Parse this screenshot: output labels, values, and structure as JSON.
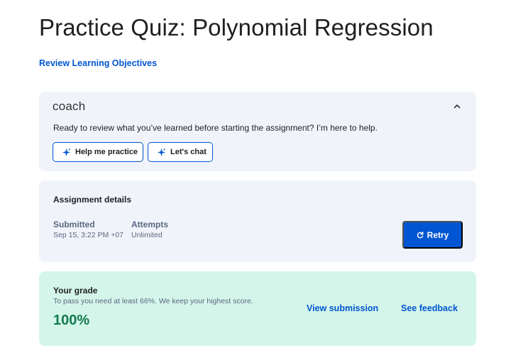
{
  "page": {
    "title": "Practice Quiz: Polynomial Regression",
    "objectives_link": "Review Learning Objectives"
  },
  "coach": {
    "logo": "coach",
    "message": "Ready to review what you’ve learned before starting the assignment? I’m here to help.",
    "buttons": [
      "Help me practice",
      "Let's chat"
    ],
    "collapse_icon": "chevron-up-icon",
    "button_icon": "sparkle-icon"
  },
  "details": {
    "title": "Assignment details",
    "submitted_label": "Submitted",
    "submitted_value": "Sep 15, 3:22 PM +07",
    "attempts_label": "Attempts",
    "attempts_value": "Unlimited",
    "retry_label": "Retry",
    "retry_icon": "retry-icon"
  },
  "grade": {
    "title": "Your grade",
    "subtitle": "To pass you need at least 66%. We keep your highest score.",
    "value": "100%",
    "view_submission": "View submission",
    "see_feedback": "See feedback"
  },
  "colors": {
    "accent": "#0056d2",
    "card_bg": "#f0f4fa",
    "grade_bg": "#d4f5ea",
    "grade_text": "#137a4f"
  }
}
